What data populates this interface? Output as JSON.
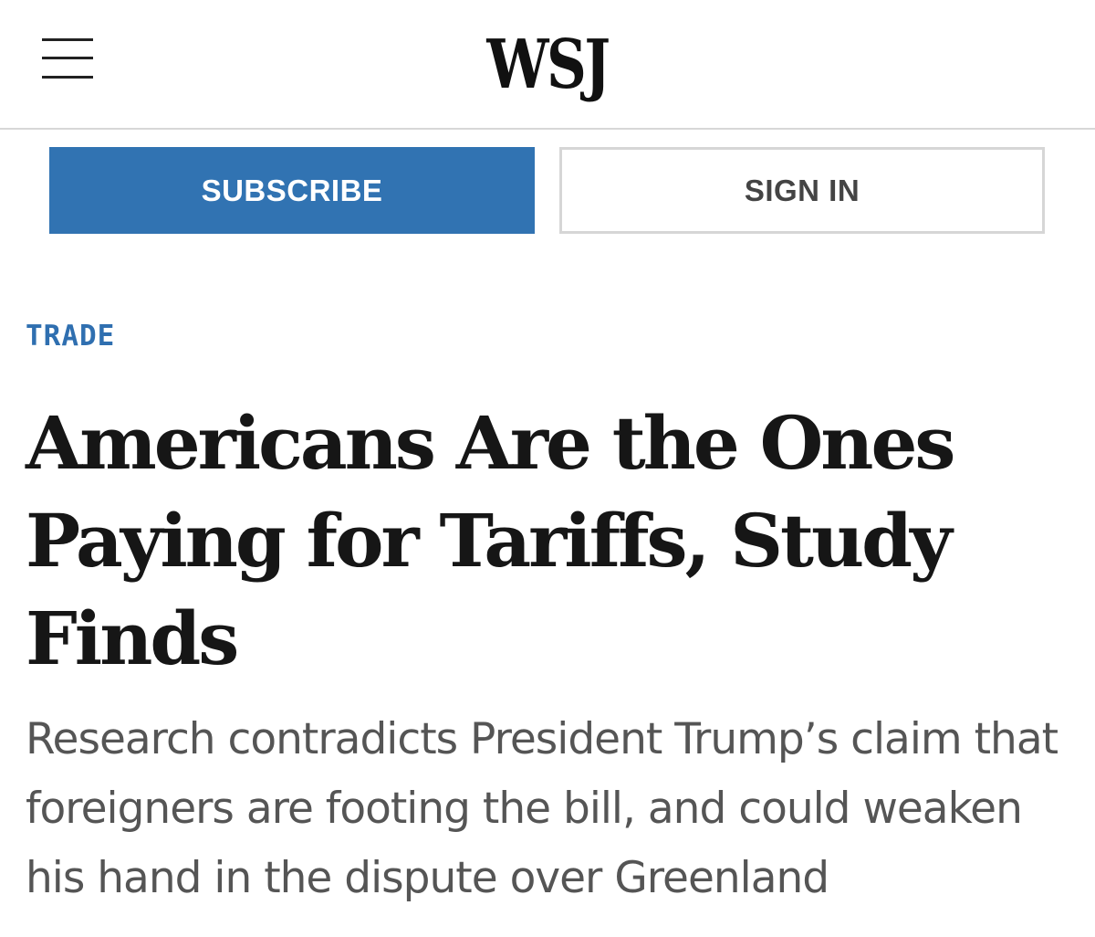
{
  "header": {
    "logo": "WSJ",
    "menu_icon": "hamburger-menu-icon"
  },
  "actions": {
    "subscribe_label": "SUBSCRIBE",
    "signin_label": "SIGN IN"
  },
  "article": {
    "section": "TRADE",
    "headline": "Americans Are the Ones Paying for Tariffs, Study Finds",
    "dek": "Research contradicts President Trump’s claim that foreigners are footing the bill, and could weaken his hand in the dispute over Greenland"
  },
  "colors": {
    "accent": "#3173b2",
    "section_label": "#2f6fb0",
    "headline": "#161616",
    "dek": "#555555"
  }
}
